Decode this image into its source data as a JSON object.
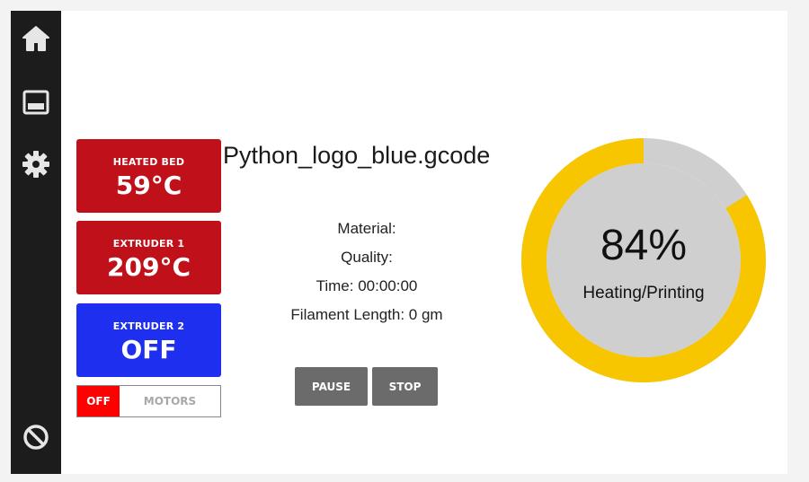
{
  "sidebar": {
    "items": [
      {
        "icon": "home-icon"
      },
      {
        "icon": "display-panel-icon"
      },
      {
        "icon": "gear-icon"
      },
      {
        "icon": "cancel-circle-icon"
      }
    ]
  },
  "temps": {
    "heated_bed": {
      "label": "HEATED BED",
      "value": "59°C",
      "color": "#c0101a"
    },
    "extruder1": {
      "label": "EXTRUDER 1",
      "value": "209°C",
      "color": "#c0101a"
    },
    "extruder2": {
      "label": "EXTRUDER 2",
      "value": "OFF",
      "color": "#1e2ff0"
    }
  },
  "motors": {
    "state": "OFF",
    "label": "MOTORS"
  },
  "job": {
    "filename": "Python_logo_blue.gcode",
    "material": "Material:",
    "quality": "Quality:",
    "time": "Time: 00:00:00",
    "filament": "Filament Length: 0 gm"
  },
  "controls": {
    "pause_label": "PAUSE",
    "stop_label": "STOP"
  },
  "progress": {
    "percent_text": "84%",
    "fraction": 0.84,
    "status": "Heating/Printing",
    "ring_color": "#f7c600",
    "track_color": "#cfcfcf"
  }
}
